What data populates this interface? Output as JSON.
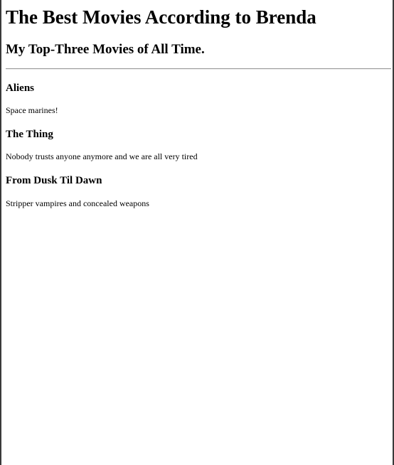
{
  "page": {
    "title": "The Best Movies According to Brenda",
    "subtitle": "My Top-Three Movies of All Time."
  },
  "movies": [
    {
      "title": "Aliens",
      "description": "Space marines!"
    },
    {
      "title": "The Thing",
      "description": "Nobody trusts anyone anymore and we are all very tired"
    },
    {
      "title": "From Dusk Til Dawn",
      "description": "Stripper vampires and concealed weapons"
    }
  ]
}
